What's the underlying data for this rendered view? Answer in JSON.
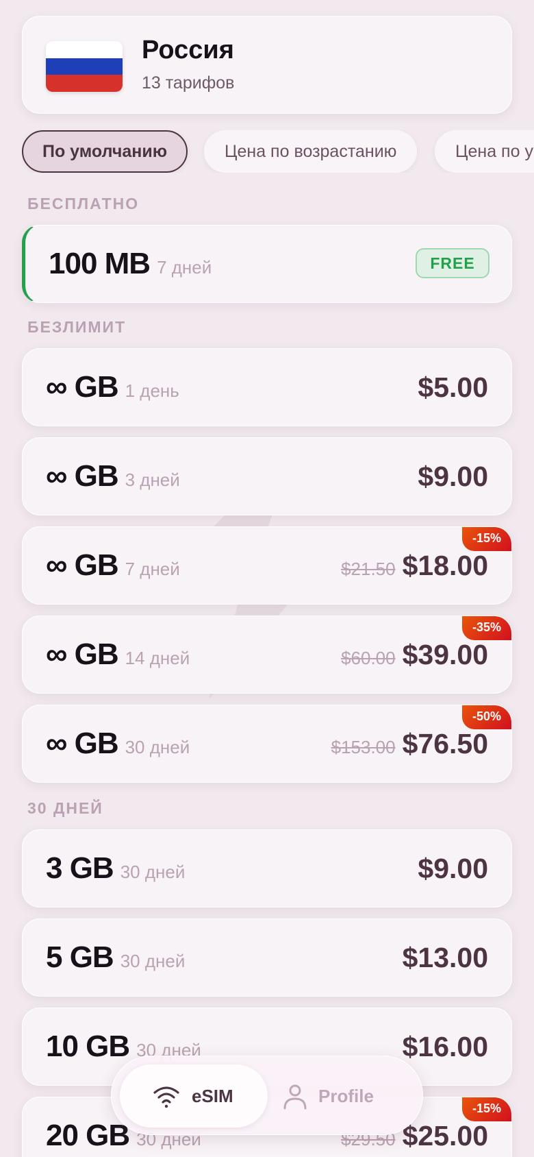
{
  "header": {
    "country_name": "Россия",
    "tariff_count": "13 тарифов",
    "flag_colors": [
      "#ffffff",
      "#1f3fb8",
      "#d6322b"
    ]
  },
  "sort_chips": [
    {
      "label": "По умолчанию",
      "active": true
    },
    {
      "label": "Цена по возрастанию",
      "active": false
    },
    {
      "label": "Цена по у",
      "active": false
    }
  ],
  "sections": {
    "free": "БЕСПЛАТНО",
    "unlimited": "БЕЗЛИМИТ",
    "days30": "30 ДНЕЙ"
  },
  "plans": [
    {
      "size": "100 MB",
      "days": "7 дней",
      "badge": "FREE"
    },
    {
      "size": "∞ GB",
      "days": "1 день",
      "price": "$5.00"
    },
    {
      "size": "∞ GB",
      "days": "3 дней",
      "price": "$9.00"
    },
    {
      "size": "∞ GB",
      "days": "7 дней",
      "old_price": "$21.50",
      "price": "$18.00",
      "discount": "-15%"
    },
    {
      "size": "∞ GB",
      "days": "14 дней",
      "old_price": "$60.00",
      "price": "$39.00",
      "discount": "-35%"
    },
    {
      "size": "∞ GB",
      "days": "30 дней",
      "old_price": "$153.00",
      "price": "$76.50",
      "discount": "-50%"
    },
    {
      "size": "3 GB",
      "days": "30 дней",
      "price": "$9.00"
    },
    {
      "size": "5 GB",
      "days": "30 дней",
      "price": "$13.00"
    },
    {
      "size": "10 GB",
      "days": "30 дней",
      "price": "$16.00"
    },
    {
      "size": "20 GB",
      "days": "30 дней",
      "old_price": "$29.50",
      "price": "$25.00",
      "discount": "-15%"
    }
  ],
  "nav": {
    "esim_label": "eSIM",
    "esim_icon": "wifi-icon",
    "profile_label": "Profile",
    "profile_icon": "user-icon"
  },
  "colors": {
    "accent_free": "#25a14b",
    "discount_gradient": [
      "#e8550a",
      "#d2101f"
    ],
    "price": "#4d3443"
  }
}
